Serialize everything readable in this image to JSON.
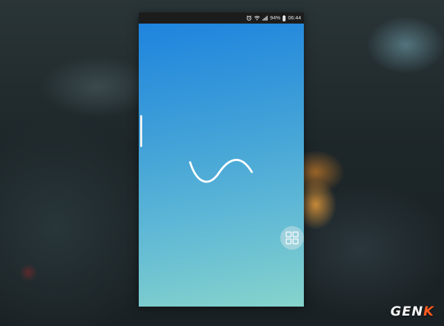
{
  "status_bar": {
    "icons": [
      "alarm-icon",
      "wifi-icon",
      "signal-icon",
      "battery-icon"
    ],
    "battery_percent": "94%",
    "time": "06:44"
  },
  "screen": {
    "background_top": "#1e84de",
    "background_bottom": "#86d4cc",
    "center_icon": "sine-wave-icon"
  },
  "floating_button": {
    "icon": "grid-icon"
  },
  "watermark": {
    "text_main": "GEN",
    "text_accent": "K",
    "accent_color": "#ff5a1e"
  }
}
